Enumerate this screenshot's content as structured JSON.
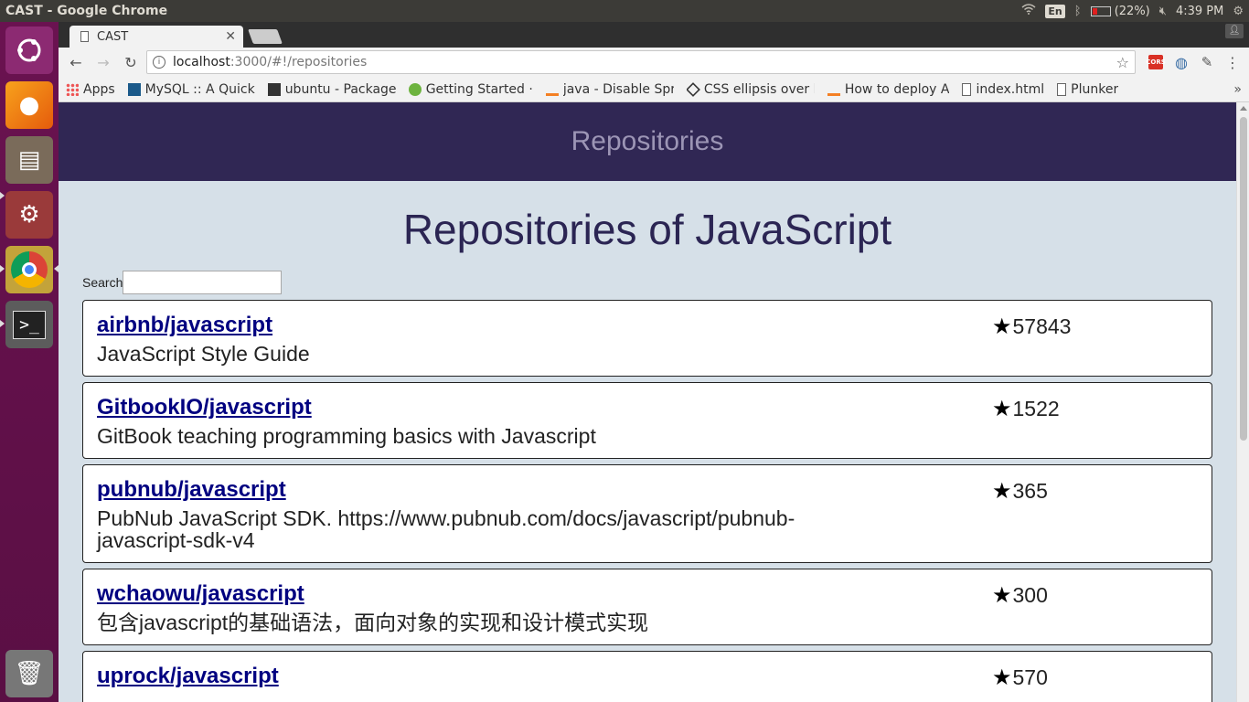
{
  "os": {
    "window_title": "CAST - Google Chrome",
    "lang": "En",
    "battery": "(22%)",
    "clock": "4:39 PM"
  },
  "launcher": {
    "items": [
      "ubuntu-dash",
      "firefox",
      "files",
      "system-settings",
      "chrome",
      "terminal",
      "trash"
    ]
  },
  "browser": {
    "tab_title": "CAST",
    "url_host": "localhost",
    "url_path": ":3000/#!/repositories",
    "bookmarks": [
      {
        "label": "Apps",
        "icon": "apps-icon"
      },
      {
        "label": "MySQL :: A Quick",
        "icon": "mysql-icon"
      },
      {
        "label": "ubuntu - Package",
        "icon": "ubuntu-icon"
      },
      {
        "label": "Getting Started ·",
        "icon": "spring-icon"
      },
      {
        "label": "java - Disable Spr",
        "icon": "stackoverflow-icon"
      },
      {
        "label": "CSS ellipsis over l",
        "icon": "codepen-icon"
      },
      {
        "label": "How to deploy A",
        "icon": "stackoverflow-icon"
      },
      {
        "label": "index.html",
        "icon": "page-icon"
      },
      {
        "label": "Plunker",
        "icon": "page-icon"
      }
    ],
    "bookmarks_more": "»"
  },
  "app": {
    "header": "Repositories",
    "title": "Repositories of JavaScript",
    "search_label": "Search",
    "search_value": "",
    "repos": [
      {
        "name": "airbnb/javascript",
        "description": "JavaScript Style Guide",
        "stars": "57843"
      },
      {
        "name": "GitbookIO/javascript",
        "description": "GitBook teaching programming basics with Javascript",
        "stars": "1522"
      },
      {
        "name": "pubnub/javascript",
        "description": "PubNub JavaScript SDK. https://www.pubnub.com/docs/javascript/pubnub-javascript-sdk-v4",
        "stars": "365"
      },
      {
        "name": "wchaowu/javascript",
        "description": "包含javascript的基础语法，面向对象的实现和设计模式实现",
        "stars": "300"
      },
      {
        "name": "uprock/javascript",
        "description": "",
        "stars": "570"
      }
    ]
  }
}
